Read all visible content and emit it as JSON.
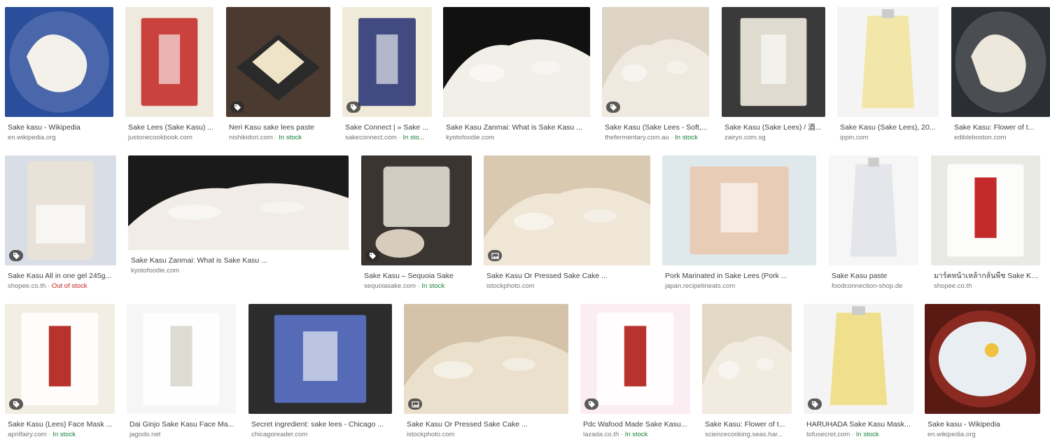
{
  "results": [
    {
      "title": "Sake kasu - Wikipedia",
      "source": "en.wikipedia.org",
      "stock": "",
      "badge": "",
      "icon": "bowl-image",
      "colors": [
        "#2a4d9c",
        "#f4f1ea"
      ]
    },
    {
      "title": "Sake Lees (Sake Kasu) ...",
      "source": "justonecookbook.com",
      "stock": "",
      "badge": "",
      "icon": "package-image",
      "colors": [
        "#efe9de",
        "#c4302b"
      ]
    },
    {
      "title": "Neri Kasu sake lees paste",
      "source": "nishikidori.com",
      "stock": "In stock",
      "badge": "tag",
      "icon": "plate-image",
      "colors": [
        "#4a3a30",
        "#efe4c7"
      ]
    },
    {
      "title": "Sake Connect | » Sake ...",
      "source": "sakeconnect.com",
      "stock": "In sto...",
      "badge": "tag",
      "icon": "package-image",
      "colors": [
        "#f0ead8",
        "#2d3a78"
      ]
    },
    {
      "title": "Sake Kasu Zanmai: What is Sake Kasu ...",
      "source": "kyotofoodie.com",
      "stock": "",
      "badge": "",
      "icon": "lees-image",
      "colors": [
        "#111111",
        "#f2efe9"
      ]
    },
    {
      "title": "Sake Kasu (Sake Lees - Soft,...",
      "source": "thefermentary.com.au",
      "stock": "In stock",
      "badge": "tag",
      "icon": "lees-image",
      "colors": [
        "#ddd4c6",
        "#efe9df"
      ]
    },
    {
      "title": "Sake Kasu (Sake Lees) / 酒...",
      "source": "zairyo.com.sg",
      "stock": "",
      "badge": "",
      "icon": "package-image",
      "colors": [
        "#3a3a3a",
        "#f3ede0"
      ]
    },
    {
      "title": "Sake Kasu (Sake Lees), 20...",
      "source": "ippin.com",
      "stock": "",
      "badge": "",
      "icon": "pouch-image",
      "colors": [
        "#f4f4f4",
        "#f2e6a8"
      ]
    },
    {
      "title": "Sake Kasu: Flower of t...",
      "source": "edibleboston.com",
      "stock": "",
      "badge": "",
      "icon": "bowl-image",
      "colors": [
        "#2b2e33",
        "#ede7dc"
      ]
    },
    {
      "title": "Sake Kasu All in one gel 245g...",
      "source": "shopee.co.th",
      "stock": "Out of stock",
      "badge": "tag",
      "icon": "bottle-image",
      "colors": [
        "#d9dde6",
        "#e8e2d8"
      ]
    },
    {
      "title": "Sake Kasu Zanmai: What is Sake Kasu ...",
      "source": "kyotofoodie.com",
      "stock": "",
      "badge": "",
      "icon": "lees-image",
      "colors": [
        "#1a1a1a",
        "#f1ede6"
      ]
    },
    {
      "title": "Sake Kasu – Sequoia Sake",
      "source": "sequoiasake.com",
      "stock": "In stock",
      "badge": "tag",
      "icon": "container-image",
      "colors": [
        "#3a3530",
        "#ece6dc"
      ]
    },
    {
      "title": "Sake Kasu Or Pressed Sake Cake ...",
      "source": "istockphoto.com",
      "stock": "",
      "badge": "image",
      "icon": "lees-image",
      "colors": [
        "#d8c9b0",
        "#efe6d6"
      ]
    },
    {
      "title": "Pork Marinated in Sake Lees (Pork ...",
      "source": "japan.recipetineats.com",
      "stock": "",
      "badge": "",
      "icon": "package-image",
      "colors": [
        "#dfe8ea",
        "#e9c9b0"
      ]
    },
    {
      "title": "Sake Kasu paste",
      "source": "foodconnection-shop.de",
      "stock": "",
      "badge": "",
      "icon": "pouch-image",
      "colors": [
        "#f6f6f6",
        "#e4e6ec"
      ]
    },
    {
      "title": "มาร์คหน้าเหล้ากลั่นพืช Sake Ka...",
      "source": "shopee.co.th",
      "stock": "",
      "badge": "",
      "icon": "mask-image",
      "colors": [
        "#e9eae4",
        "#c42a2a"
      ]
    },
    {
      "title": "Sake Kasu (Lees) Face Mask ...",
      "source": "aprilfairy.com",
      "stock": "In stock",
      "badge": "tag",
      "icon": "mask-image",
      "colors": [
        "#f3eee4",
        "#b8322e"
      ]
    },
    {
      "title": "Dai Ginjo Sake Kasu Face Ma...",
      "source": "jagodo.net",
      "stock": "",
      "badge": "",
      "icon": "mask-image",
      "colors": [
        "#f6f6f6",
        "#dedbd2"
      ]
    },
    {
      "title": "Secret ingredient: sake lees - Chicago ...",
      "source": "chicagoreader.com",
      "stock": "",
      "badge": "",
      "icon": "package-image",
      "colors": [
        "#2c2c2c",
        "#5a72c8"
      ]
    },
    {
      "title": "Sake Kasu Or Pressed Sake Cake ...",
      "source": "istockphoto.com",
      "stock": "",
      "badge": "image",
      "icon": "lees-image",
      "colors": [
        "#d4c3a8",
        "#ebe0cc"
      ]
    },
    {
      "title": "Pdc Wafood Made Sake Kasu...",
      "source": "lazada.co.th",
      "stock": "In stock",
      "badge": "tag",
      "icon": "mask-image",
      "colors": [
        "#fbeef2",
        "#b8322e"
      ]
    },
    {
      "title": "Sake Kasu: Flower of t...",
      "source": "sciencecooking.seas.har...",
      "stock": "",
      "badge": "",
      "icon": "lees-image",
      "colors": [
        "#e3d9c7",
        "#f1ebe0"
      ]
    },
    {
      "title": "HARUHADA Sake Kasu Mask...",
      "source": "tofusecret.com",
      "stock": "In stock",
      "badge": "tag",
      "icon": "pouch-image",
      "colors": [
        "#f4f4f4",
        "#f0df8c"
      ]
    },
    {
      "title": "Sake kasu - Wikipedia",
      "source": "en.wikipedia.org",
      "stock": "",
      "badge": "",
      "icon": "soup-image",
      "colors": [
        "#5a1a14",
        "#e9eef2"
      ]
    }
  ]
}
